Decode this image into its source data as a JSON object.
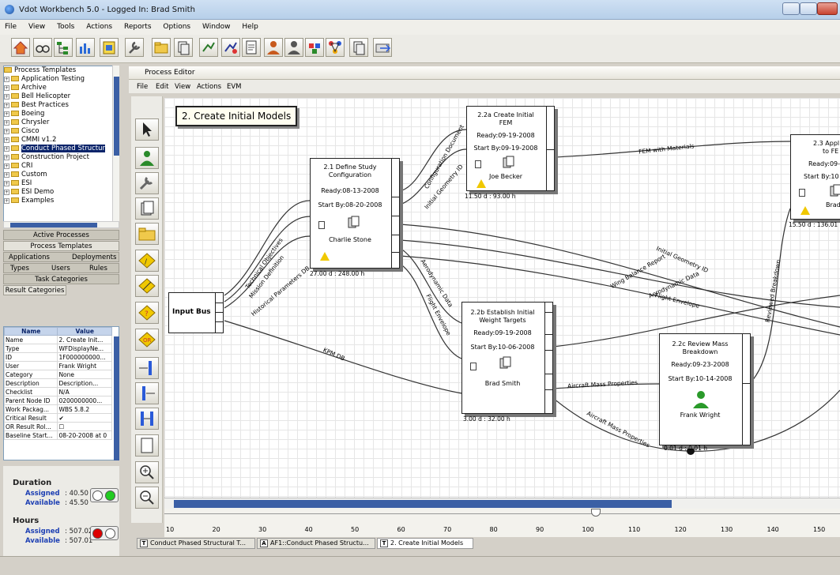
{
  "window": {
    "title": "Vdot Workbench 5.0 - Logged In: Brad Smith"
  },
  "menu": [
    "File",
    "View",
    "Tools",
    "Actions",
    "Reports",
    "Options",
    "Window",
    "Help"
  ],
  "tree": {
    "root": "Process Templates",
    "items": [
      "Application Testing",
      "Archive",
      "Bell Helicopter",
      "Best Practices",
      "Boeing",
      "Chrysler",
      "Cisco",
      "CMMI v1.2",
      "Conduct Phased Structur",
      "Construction Project",
      "CRI",
      "Custom",
      "ESI",
      "ESI Demo",
      "Examples"
    ],
    "selected_index": 8
  },
  "nav": {
    "active_processes": "Active Processes",
    "process_templates": "Process Templates",
    "applications": "Applications",
    "deployments": "Deployments",
    "types": "Types",
    "users": "Users",
    "rules": "Rules",
    "task_categories": "Task Categories",
    "result_categories": "Result Categories"
  },
  "props": {
    "headers": [
      "Name",
      "Value"
    ],
    "rows": [
      [
        "Name",
        "2. Create Init..."
      ],
      [
        "Type",
        "WFDisplayNe..."
      ],
      [
        "ID",
        "1F000000000..."
      ],
      [
        "User",
        "Frank Wright"
      ],
      [
        "Category",
        "None"
      ],
      [
        "Description",
        "Description..."
      ],
      [
        "Checklist",
        "N/A"
      ],
      [
        "Parent Node ID",
        "0200000000..."
      ],
      [
        "Work Packag...",
        "WBS 5.8.2"
      ],
      [
        "Critical Result",
        "✔"
      ],
      [
        "OR Result Rol...",
        "☐"
      ],
      [
        "Baseline Start...",
        "08-20-2008 at 0"
      ]
    ]
  },
  "duration": {
    "title": "Duration",
    "assigned_label": "Assigned",
    "assigned": ": 40.50",
    "available_label": "Available",
    "available": ": 45.50"
  },
  "hours": {
    "title": "Hours",
    "assigned_label": "Assigned",
    "assigned": ": 507.02",
    "available_label": "Available",
    "available": ": 507.01"
  },
  "editor": {
    "title": "Process Editor",
    "menu": [
      "File",
      "Edit",
      "View",
      "Actions",
      "EVM"
    ],
    "stage_label": "2. Create Initial Models",
    "input_bus": "Input Bus",
    "nodes": {
      "n21": {
        "title1": "2.1 Define Study",
        "title2": "Configuration",
        "ready": "Ready:08-13-2008",
        "start": "Start By:08-20-2008",
        "who": "Charlie Stone",
        "meta": "27.00 d  :  248.00 h"
      },
      "n22a": {
        "title1": "2.2a Create Initial",
        "title2": "FEM",
        "ready": "Ready:09-19-2008",
        "start": "Start By:09-19-2008",
        "who": "Joe Becker",
        "meta": "11.50 d  :  93.00 h"
      },
      "n22b": {
        "title1": "2.2b Establish Initial",
        "title2": "Weight Targets",
        "ready": "Ready:09-19-2008",
        "start": "Start By:10-06-2008",
        "who": "Brad Smith",
        "meta": "3.00 d  :  32.00 h"
      },
      "n22c": {
        "title1": "2.2c Review Mass",
        "title2": "Breakdown",
        "ready": "Ready:09-23-2008",
        "start": "Start By:10-14-2008",
        "who": "Frank Wright",
        "meta": "0.01 d  :  0.01 h"
      },
      "n23": {
        "title1": "2.3 Appl",
        "title2": "to FE",
        "ready": "Ready:09-",
        "start": "Start By:10",
        "who": "Brad S",
        "meta": "15.50 d  :  136.01"
      }
    },
    "edges": [
      "Technical Objectives",
      "Mission Definition",
      "Historical Parameters DB",
      "KPM DB",
      "Configuration Document",
      "Initial Geometry ID",
      "FEM with Materials",
      "Aerodynamic Data",
      "Flight Envelope",
      "Aircraft Mass Properties",
      "Reviewed Breakdown",
      "Wing Balance Report",
      "Initial Geometry ID",
      "Aerodynamic Data",
      "Flight Envelope",
      "Aircraft Mass Properties"
    ],
    "ruler_ticks": [
      "10",
      "20",
      "30",
      "40",
      "50",
      "60",
      "70",
      "80",
      "90",
      "100",
      "110",
      "120",
      "130",
      "140",
      "150"
    ],
    "tabs": [
      {
        "icon": "T",
        "label": "Conduct Phased Structural T..."
      },
      {
        "icon": "A",
        "label": "AF1::Conduct Phased Structu..."
      },
      {
        "icon": "T",
        "label": "2. Create Initial Models"
      }
    ]
  },
  "colors": {
    "accent": "#3b5fa5",
    "selection": "#0a246a",
    "warn": "#f0c800",
    "ok": "#22cc22",
    "bad": "#dd0000"
  }
}
